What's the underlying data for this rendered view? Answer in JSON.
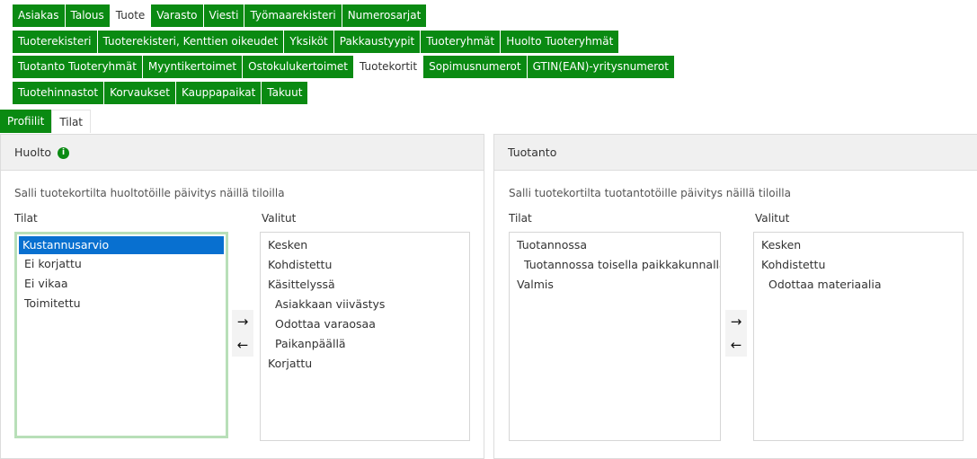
{
  "tabs_row1": [
    {
      "label": "Asiakas",
      "active": false
    },
    {
      "label": "Talous",
      "active": false
    },
    {
      "label": "Tuote",
      "active": true
    },
    {
      "label": "Varasto",
      "active": false
    },
    {
      "label": "Viesti",
      "active": false
    },
    {
      "label": "Työmaarekisteri",
      "active": false
    },
    {
      "label": "Numerosarjat",
      "active": false
    }
  ],
  "tabs_row2": [
    {
      "label": "Tuoterekisteri",
      "active": false
    },
    {
      "label": "Tuoterekisteri, Kenttien oikeudet",
      "active": false
    },
    {
      "label": "Yksiköt",
      "active": false
    },
    {
      "label": "Pakkaustyypit",
      "active": false
    },
    {
      "label": "Tuoteryhmät",
      "active": false
    },
    {
      "label": "Huolto Tuoteryhmät",
      "active": false
    }
  ],
  "tabs_row3": [
    {
      "label": "Tuotanto Tuoteryhmät",
      "active": false
    },
    {
      "label": "Myyntikertoimet",
      "active": false
    },
    {
      "label": "Ostokulukertoimet",
      "active": false
    },
    {
      "label": "Tuotekortit",
      "active": true
    },
    {
      "label": "Sopimusnumerot",
      "active": false
    },
    {
      "label": "GTIN(EAN)-yritysnumerot",
      "active": false
    }
  ],
  "tabs_row4": [
    {
      "label": "Tuotehinnastot",
      "active": false
    },
    {
      "label": "Korvaukset",
      "active": false
    },
    {
      "label": "Kauppapaikat",
      "active": false
    },
    {
      "label": "Takuut",
      "active": false
    }
  ],
  "subtabs": {
    "profiles": "Profiilit",
    "states": "Tilat"
  },
  "huolto": {
    "title": "Huolto",
    "info_icon": "i",
    "description": "Salli tuotekortilta huoltotöille päivitys näillä tiloilla",
    "available_label": "Tilat",
    "selected_label": "Valitut",
    "available": [
      {
        "label": "Kustannusarvio",
        "selected": true,
        "indent": false
      },
      {
        "label": "Ei korjattu",
        "selected": false,
        "indent": false
      },
      {
        "label": "Ei vikaa",
        "selected": false,
        "indent": false
      },
      {
        "label": "Toimitettu",
        "selected": false,
        "indent": false
      }
    ],
    "chosen": [
      {
        "label": "Kesken",
        "indent": false
      },
      {
        "label": "Kohdistettu",
        "indent": false
      },
      {
        "label": "Käsittelyssä",
        "indent": false
      },
      {
        "label": "Asiakkaan viivästys",
        "indent": true
      },
      {
        "label": "Odottaa varaosaa",
        "indent": true
      },
      {
        "label": "Paikanpäällä",
        "indent": true
      },
      {
        "label": "Korjattu",
        "indent": false
      }
    ]
  },
  "tuotanto": {
    "title": "Tuotanto",
    "description": "Salli tuotekortilta tuotantotöille päivitys näillä tiloilla",
    "available_label": "Tilat",
    "selected_label": "Valitut",
    "available": [
      {
        "label": "Tuotannossa",
        "selected": false,
        "indent": false
      },
      {
        "label": "Tuotannossa toisella paikkakunnalla",
        "selected": false,
        "indent": true
      },
      {
        "label": "Valmis",
        "selected": false,
        "indent": false
      }
    ],
    "chosen": [
      {
        "label": "Kesken",
        "indent": false
      },
      {
        "label": "Kohdistettu",
        "indent": false
      },
      {
        "label": "Odottaa materiaalia",
        "indent": true
      }
    ]
  },
  "arrows": {
    "right": "→",
    "left": "←"
  },
  "colors": {
    "accent": "#0a8a12",
    "selection": "#0870d0"
  }
}
